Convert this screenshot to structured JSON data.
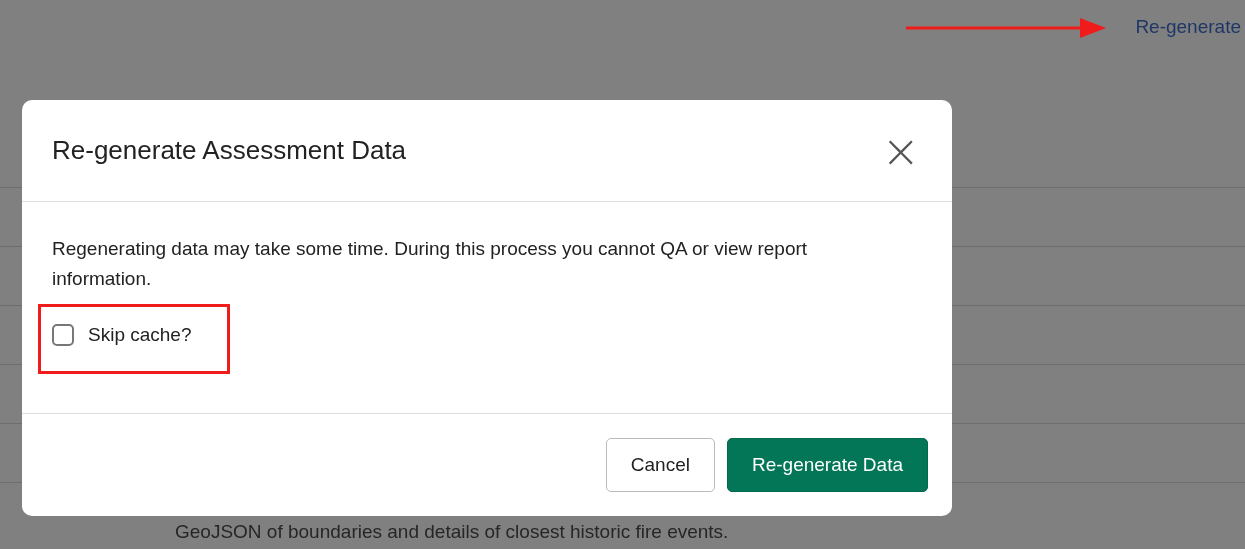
{
  "page": {
    "link": "Re-generate",
    "footer_text": "GeoJSON of boundaries and details of closest historic fire events."
  },
  "dialog": {
    "title": "Re-generate Assessment Data",
    "close": "×",
    "message": "Regenerating data may take some time. During this process you cannot QA or view report information.",
    "checkbox": {
      "label": "Skip cache?",
      "checked": false
    },
    "buttons": [
      {
        "label": "Cancel",
        "kind": "secondary"
      },
      {
        "label": "Re-generate Data",
        "kind": "primary"
      }
    ]
  }
}
